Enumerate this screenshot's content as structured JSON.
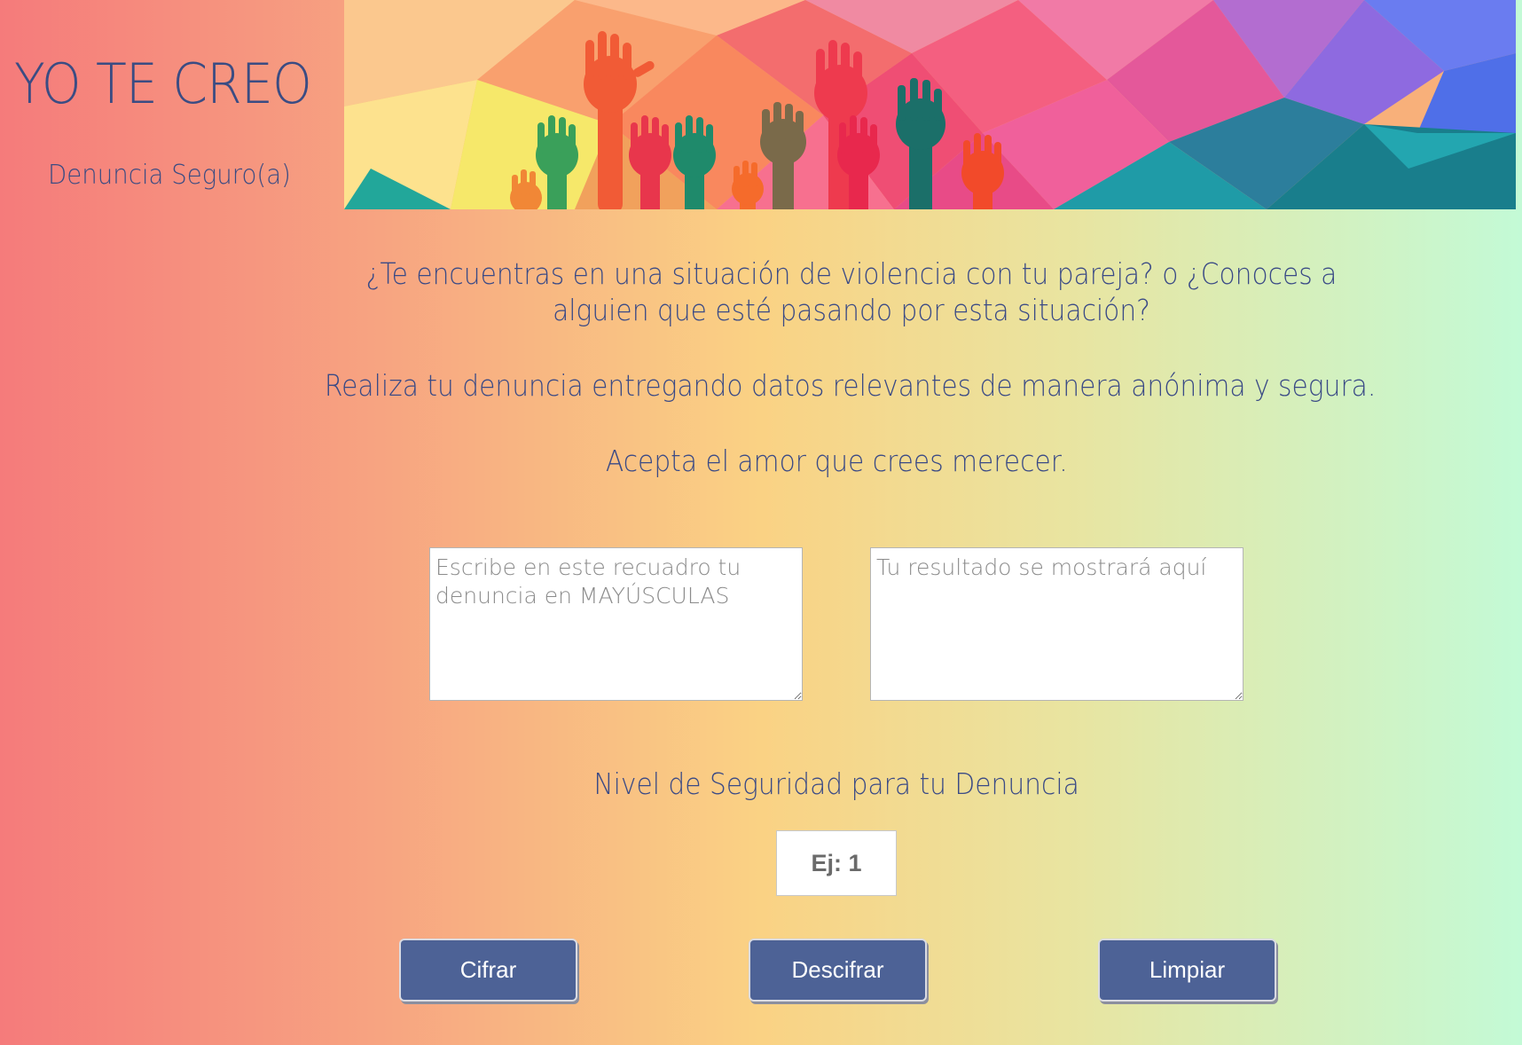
{
  "header": {
    "title": "YO TE CREO",
    "subtitle": "Denuncia Seguro(a)",
    "banner_icon": "raised-hands-banner"
  },
  "intro": {
    "question": "¿Te encuentras en una situación de violencia con tu pareja? o ¿Conoces a alguien que esté pasando por esta situación?",
    "instruction": "Realiza tu denuncia entregando datos relevantes de manera anónima y segura.",
    "motto": "Acepta el amor que crees merecer."
  },
  "form": {
    "input_placeholder": "Escribe en este recuadro tu denuncia en MAYÚSCULAS",
    "output_placeholder": "Tu resultado se mostrará aquí",
    "level_label": "Nivel de Seguridad para tu Denuncia",
    "level_placeholder": "Ej: 1"
  },
  "buttons": {
    "encrypt": "Cifrar",
    "decrypt": "Descifrar",
    "clear": "Limpiar"
  },
  "colors": {
    "text": "#3a4a86",
    "button": "#4d6296"
  }
}
